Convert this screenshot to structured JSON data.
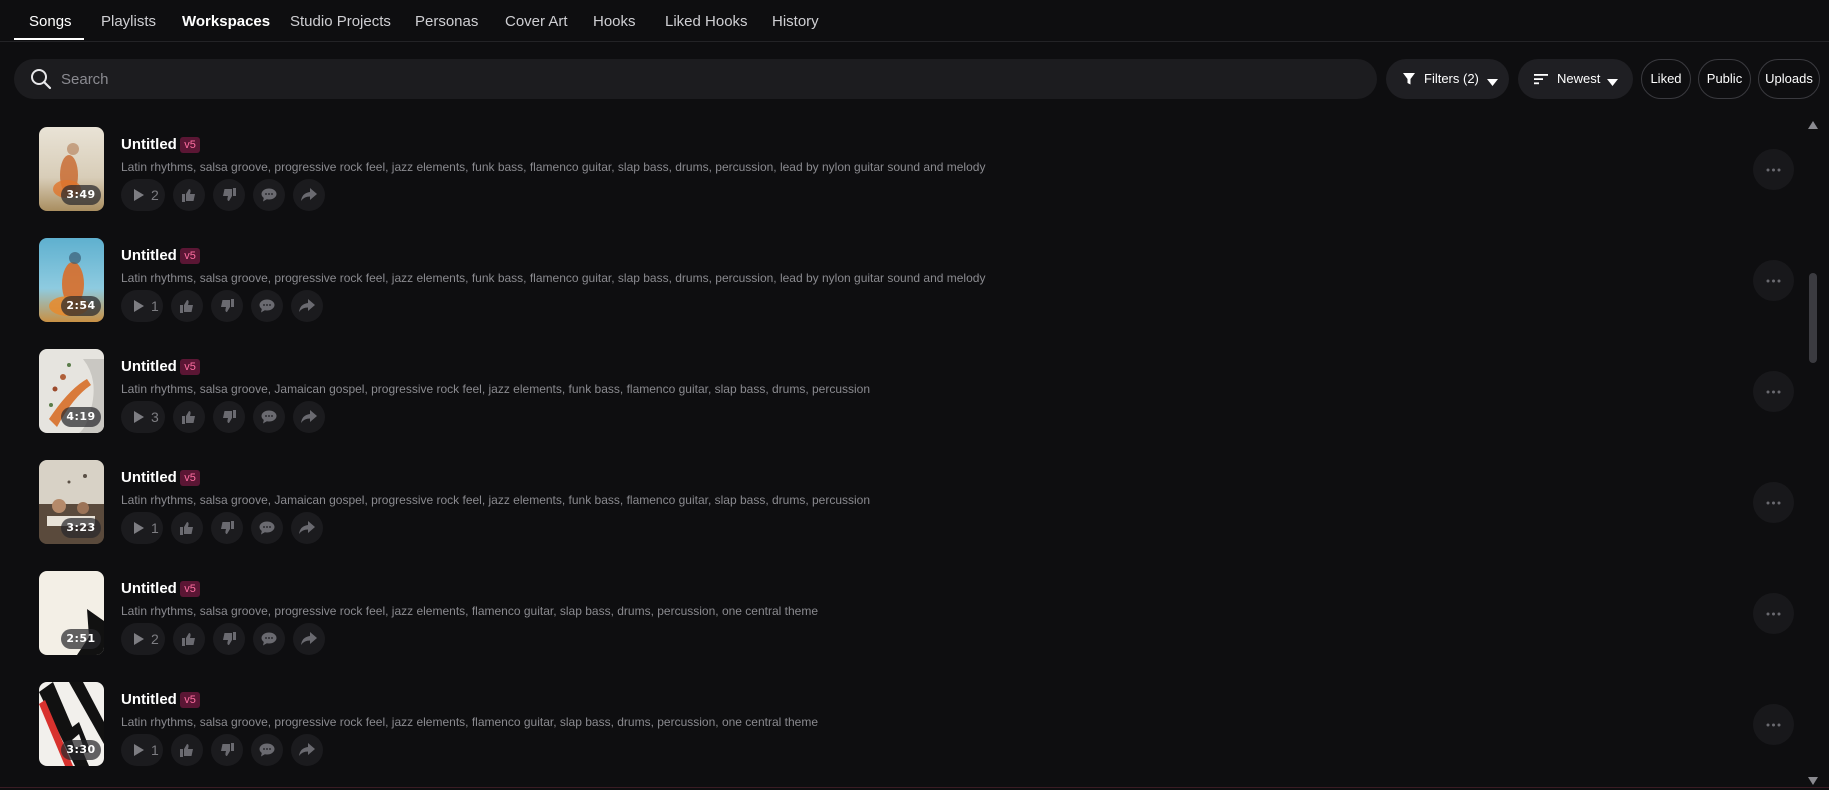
{
  "tabs": [
    {
      "label": "Songs"
    },
    {
      "label": "Playlists"
    },
    {
      "label": "Workspaces"
    },
    {
      "label": "Studio Projects"
    },
    {
      "label": "Personas"
    },
    {
      "label": "Cover Art"
    },
    {
      "label": "Hooks"
    },
    {
      "label": "Liked Hooks"
    },
    {
      "label": "History"
    }
  ],
  "search": {
    "placeholder": "Search",
    "value": ""
  },
  "toolbar": {
    "filters_label": "Filters (2)",
    "sort_label": "Newest",
    "liked_label": "Liked",
    "public_label": "Public",
    "uploads_label": "Uploads"
  },
  "songs": [
    {
      "title": "Untitled",
      "version": "v5",
      "duration": "3:49",
      "plays": "2",
      "description": "Latin rhythms, salsa groove, progressive rock feel, jazz elements, funk bass, flamenco guitar, slap bass, drums, percussion, lead by nylon guitar sound and melody"
    },
    {
      "title": "Untitled",
      "version": "v5",
      "duration": "2:54",
      "plays": "1",
      "description": "Latin rhythms, salsa groove, progressive rock feel, jazz elements, funk bass, flamenco guitar, slap bass, drums, percussion, lead by nylon guitar sound and melody"
    },
    {
      "title": "Untitled",
      "version": "v5",
      "duration": "4:19",
      "plays": "3",
      "description": "Latin rhythms, salsa groove, Jamaican gospel, progressive rock feel, jazz elements, funk bass, flamenco guitar, slap bass, drums, percussion"
    },
    {
      "title": "Untitled",
      "version": "v5",
      "duration": "3:23",
      "plays": "1",
      "description": "Latin rhythms, salsa groove, Jamaican gospel, progressive rock feel, jazz elements, funk bass, flamenco guitar, slap bass, drums, percussion"
    },
    {
      "title": "Untitled",
      "version": "v5",
      "duration": "2:51",
      "plays": "2",
      "description": "Latin rhythms, salsa groove, progressive rock feel, jazz elements, flamenco guitar, slap bass, drums, percussion, one central theme"
    },
    {
      "title": "Untitled",
      "version": "v5",
      "duration": "3:30",
      "plays": "1",
      "description": "Latin rhythms, salsa groove, progressive rock feel, jazz elements, flamenco guitar, slap bass, drums, percussion, one central theme"
    }
  ],
  "icons": {
    "search": "search-icon",
    "filter": "funnel-icon",
    "sort": "sort-icon",
    "play": "play-icon",
    "like": "thumbs-up-icon",
    "dislike": "thumbs-down-icon",
    "comment": "comment-icon",
    "share": "share-icon",
    "more": "more-dots-icon"
  },
  "colors": {
    "background": "#0e0e10",
    "version_badge_bg": "#5a1634",
    "version_badge_text": "#ff6fa2"
  }
}
